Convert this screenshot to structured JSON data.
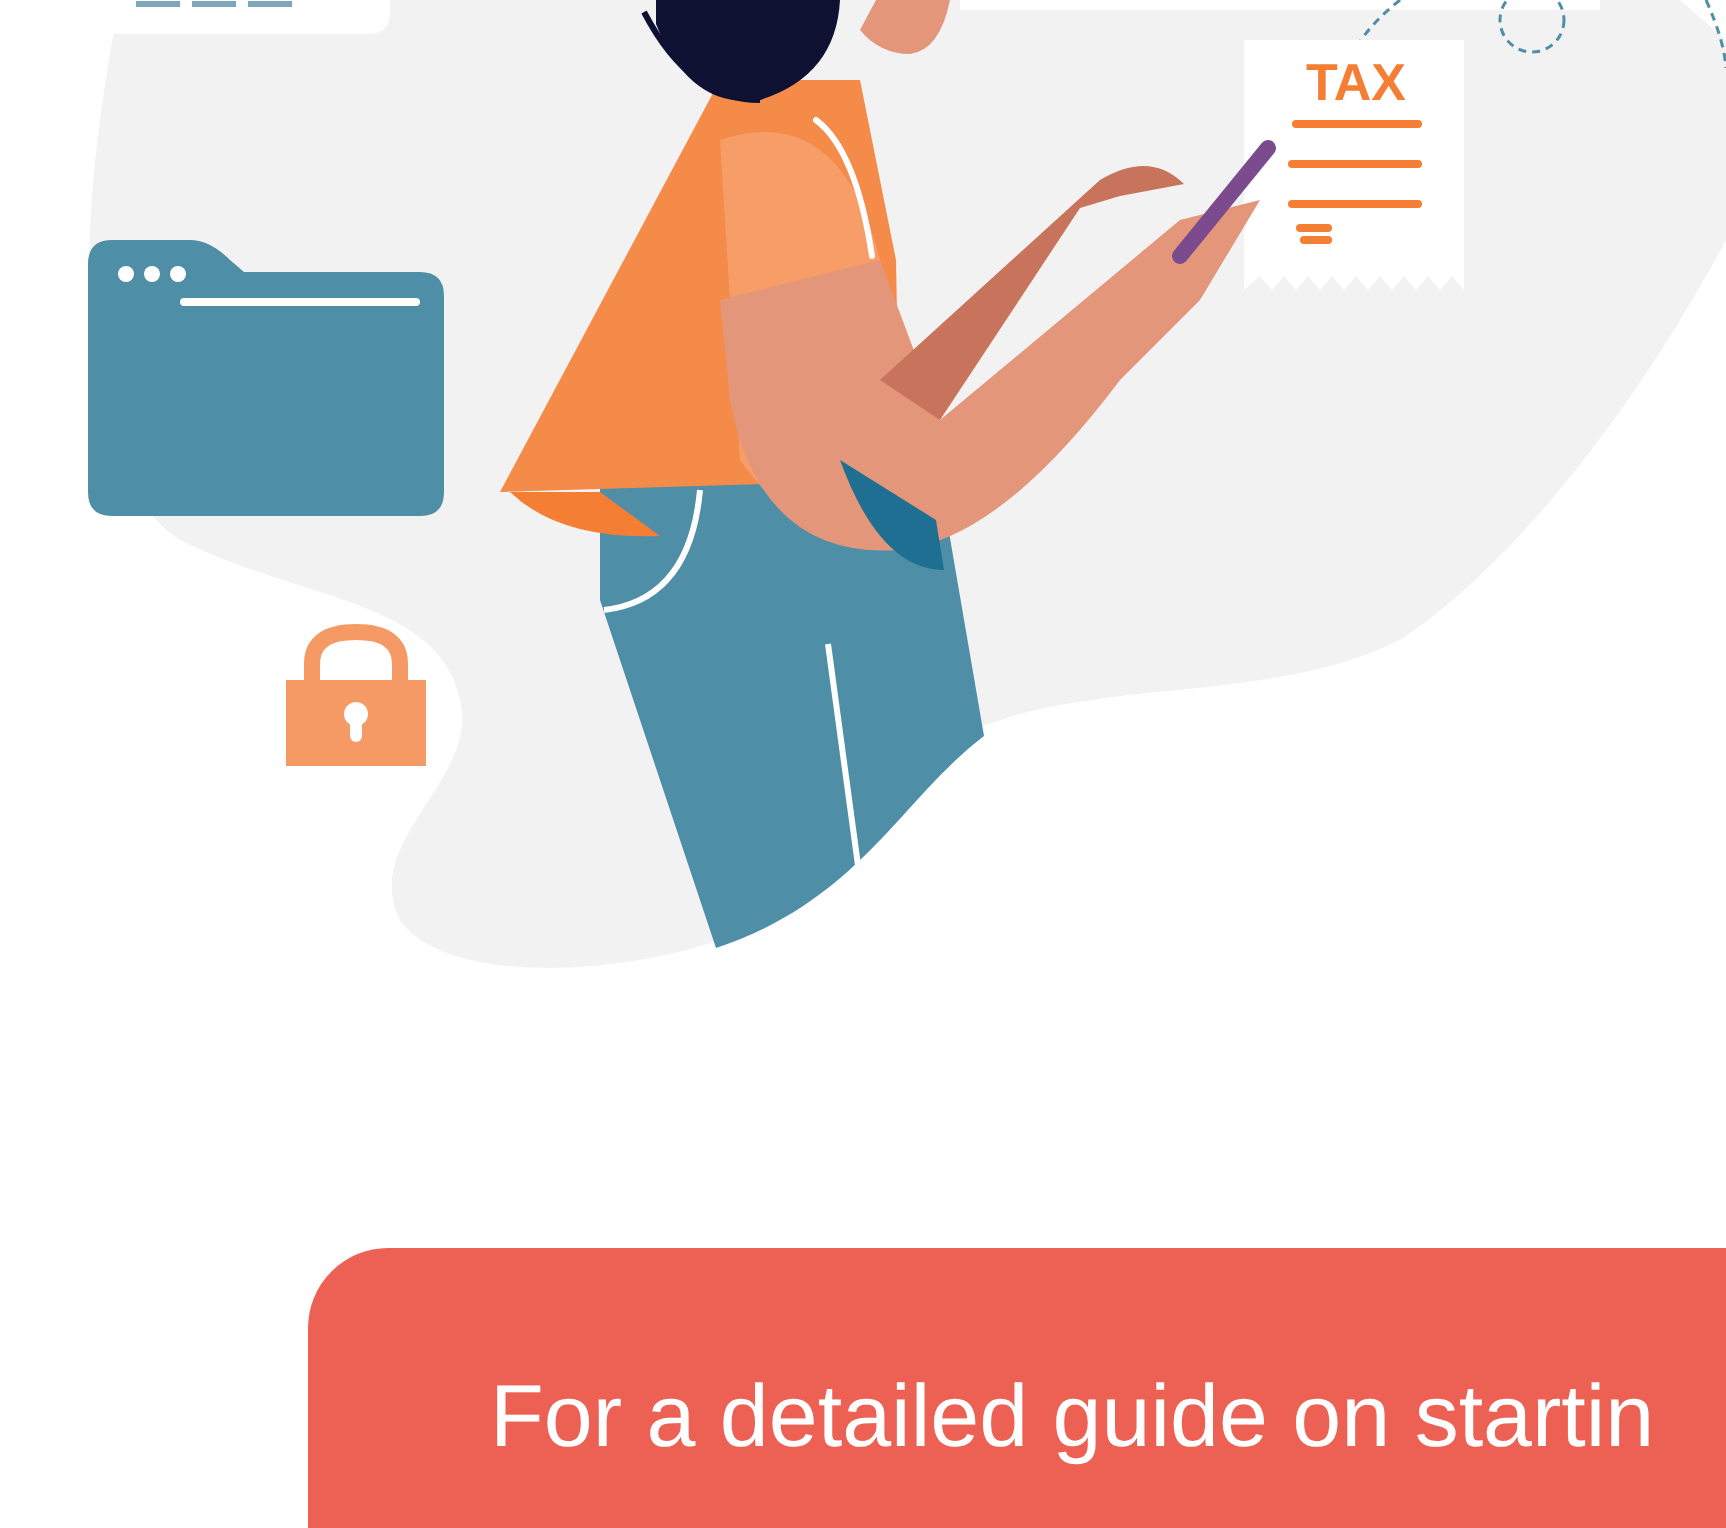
{
  "illustration": {
    "receipt_label": "TAX"
  },
  "callout": {
    "lines": [
      "For a detailed guide on startin"
    ]
  }
}
